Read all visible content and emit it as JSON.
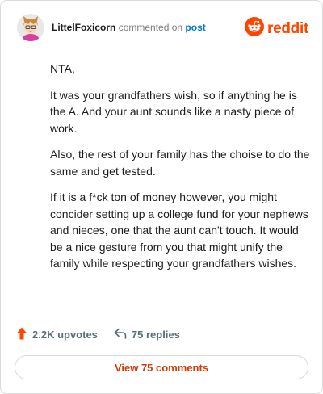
{
  "header": {
    "username": "LittelFoxicorn",
    "action": "commented on",
    "link": "post",
    "avatar_icon": "avatar-icon",
    "brand_name": "reddit",
    "brand_icon": "reddit-snoo-icon"
  },
  "comment": {
    "paragraphs": [
      "NTA,",
      "It was your grandfathers wish, so if anything he is the A. And your aunt sounds like a nasty piece of work.",
      "Also, the rest of your family has the choise to do the same and get tested.",
      "If it is a f*ck ton of money however, you might concider setting up a college fund for your nephews and nieces, one that the aunt can't touch. It would be a nice gesture from you that might unify the family while respecting your grandfathers wishes."
    ]
  },
  "footer": {
    "upvotes": "2.2K upvotes",
    "upvote_icon": "upvote-arrow-icon",
    "replies": "75 replies",
    "reply_icon": "reply-arrow-icon",
    "view_button": "View 75 comments"
  },
  "colors": {
    "brand": "#ff4500",
    "link": "#0079d3",
    "button_text": "#d93a00",
    "muted": "#576f76"
  }
}
